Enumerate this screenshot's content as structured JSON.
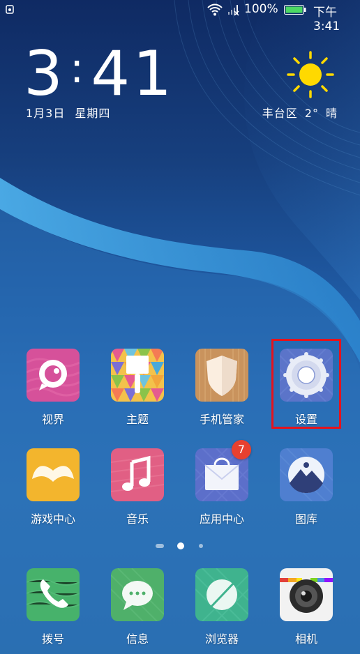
{
  "status_bar": {
    "battery_percent": "100%",
    "time": "下午3:41",
    "icons": [
      "notification-icon",
      "wifi-icon",
      "signal-icon",
      "battery-icon"
    ]
  },
  "clock_widget": {
    "hour": "3",
    "minute": "41",
    "date": "1月3日",
    "weekday": "星期四"
  },
  "weather_widget": {
    "icon": "sun-icon",
    "location": "丰台区",
    "temperature": "2°",
    "condition": "晴"
  },
  "home_apps": [
    {
      "label": "视界",
      "icon": "video-eye-icon"
    },
    {
      "label": "主题",
      "icon": "theme-brush-icon"
    },
    {
      "label": "手机管家",
      "icon": "shield-icon"
    },
    {
      "label": "设置",
      "icon": "gear-icon",
      "highlighted": true
    },
    {
      "label": "游戏中心",
      "icon": "game-controller-icon"
    },
    {
      "label": "音乐",
      "icon": "music-note-icon"
    },
    {
      "label": "应用中心",
      "icon": "shopping-bag-icon",
      "badge": "7"
    },
    {
      "label": "图库",
      "icon": "gallery-icon"
    }
  ],
  "pager": {
    "pages": 3,
    "current": 2
  },
  "dock_apps": [
    {
      "label": "拨号",
      "icon": "phone-icon"
    },
    {
      "label": "信息",
      "icon": "message-icon"
    },
    {
      "label": "浏览器",
      "icon": "browser-icon"
    },
    {
      "label": "相机",
      "icon": "camera-icon"
    }
  ],
  "colors": {
    "highlight_border": "#e5131c",
    "badge": "#e8402f"
  }
}
